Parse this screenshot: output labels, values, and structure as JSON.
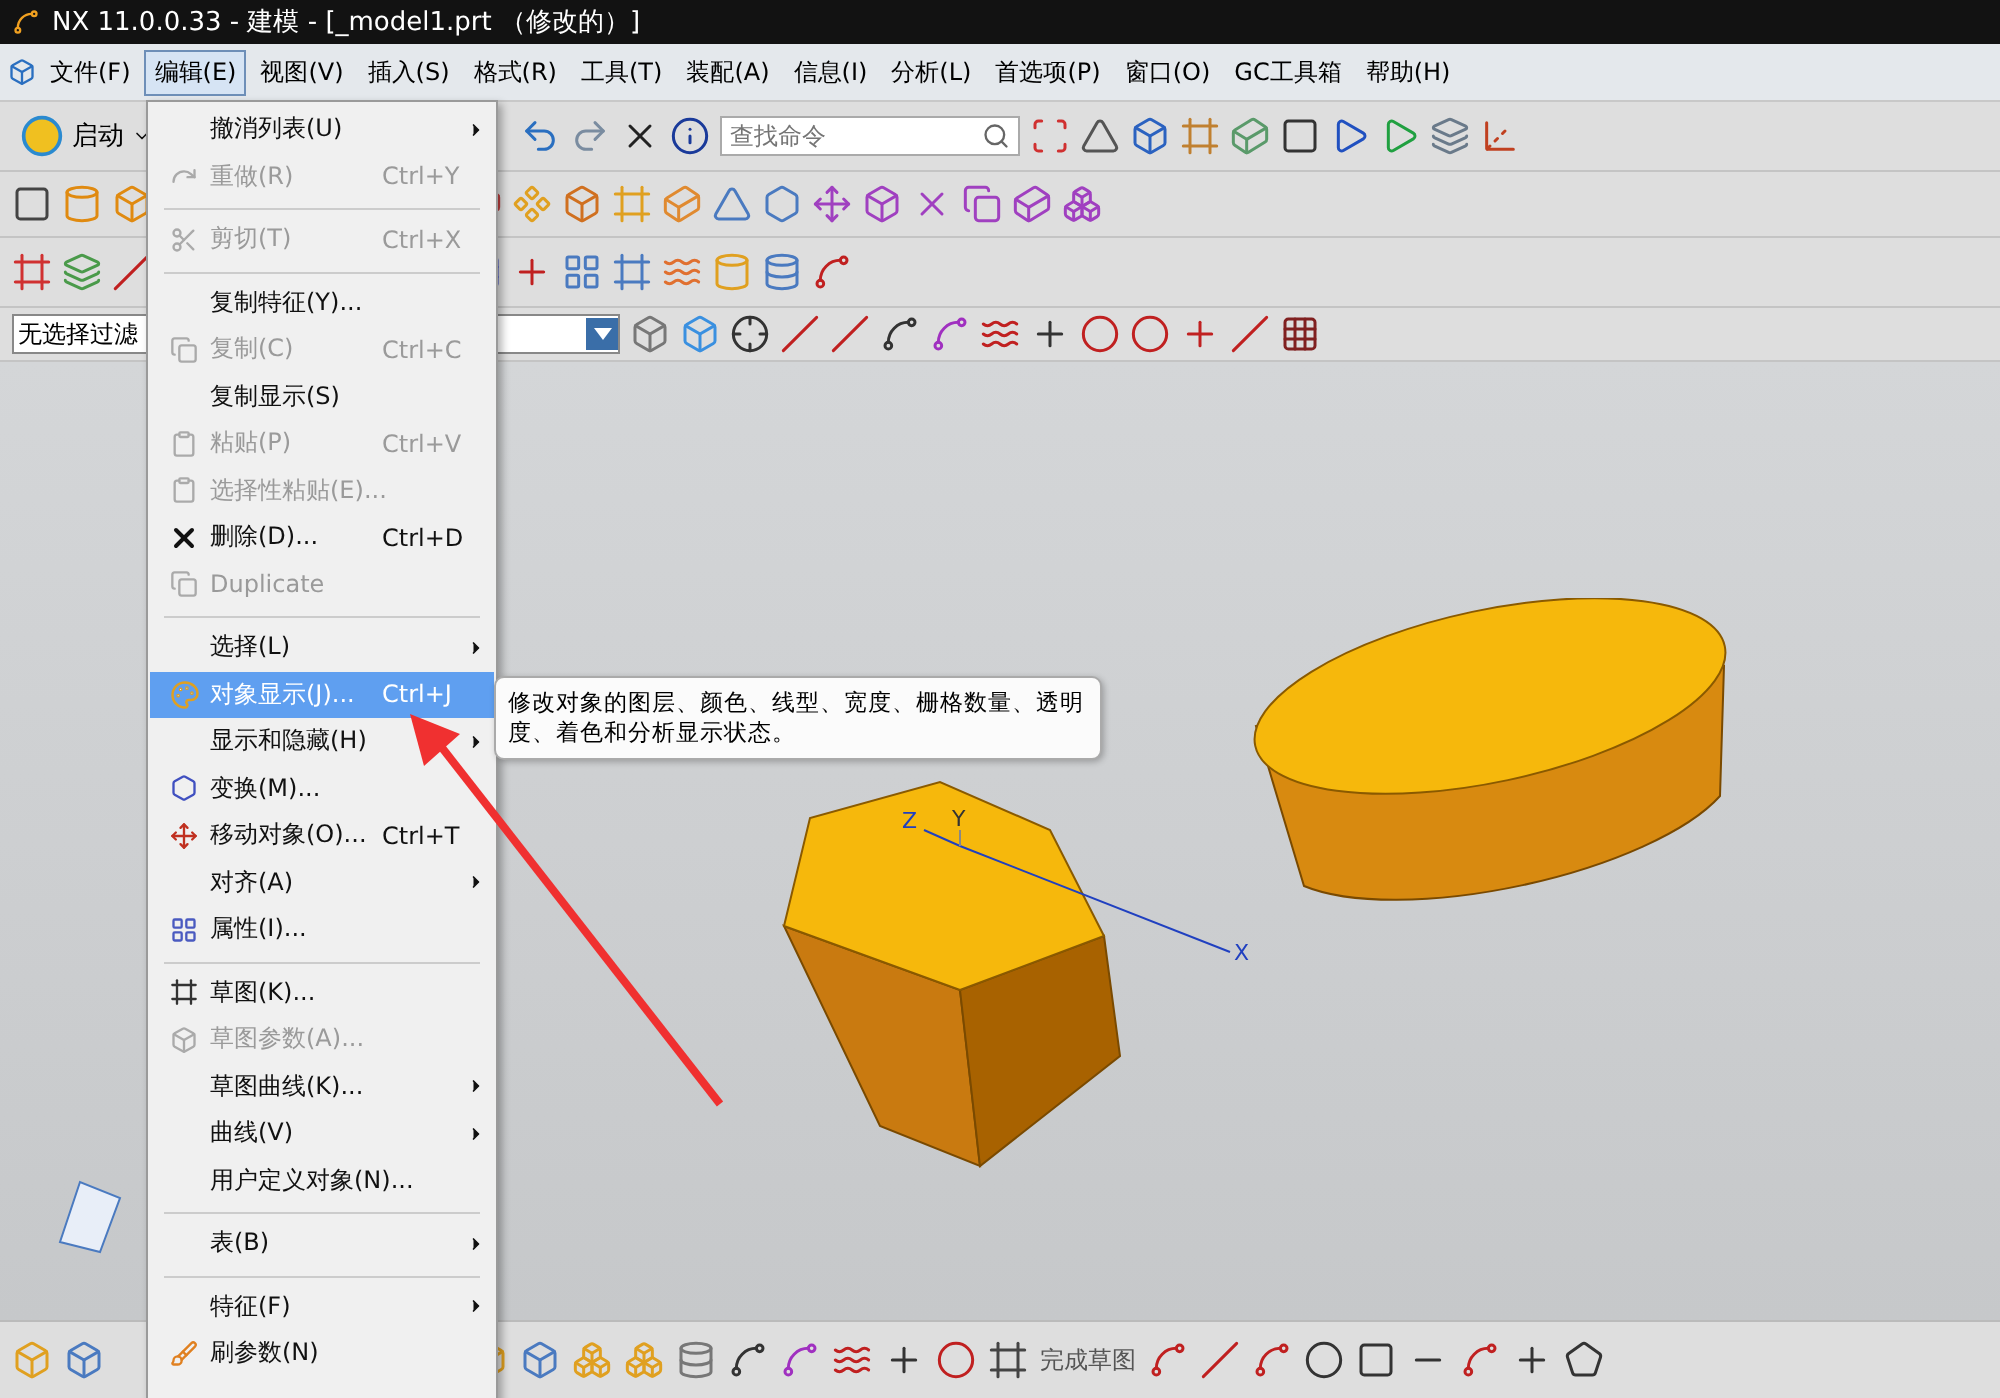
{
  "window": {
    "title": "NX 11.0.0.33 - 建模 - [_model1.prt （修改的）]"
  },
  "menu_bar": [
    {
      "label": "文件(F)",
      "selected": false
    },
    {
      "label": "编辑(E)",
      "selected": true
    },
    {
      "label": "视图(V)",
      "selected": false
    },
    {
      "label": "插入(S)",
      "selected": false
    },
    {
      "label": "格式(R)",
      "selected": false
    },
    {
      "label": "工具(T)",
      "selected": false
    },
    {
      "label": "装配(A)",
      "selected": false
    },
    {
      "label": "信息(I)",
      "selected": false
    },
    {
      "label": "分析(L)",
      "selected": false
    },
    {
      "label": "首选项(P)",
      "selected": false
    },
    {
      "label": "窗口(O)",
      "selected": false
    },
    {
      "label": "GC工具箱",
      "selected": false
    },
    {
      "label": "帮助(H)",
      "selected": false
    }
  ],
  "toolbar": {
    "start_button": "启动",
    "search": {
      "placeholder": "查找命令"
    },
    "filter": {
      "value": "无选择过滤"
    }
  },
  "edit_menu": [
    {
      "kind": "item",
      "label": "撤消列表(U)",
      "submenu": true,
      "disabled": false,
      "selected": false
    },
    {
      "kind": "item",
      "label": "重做(R)",
      "shortcut": "Ctrl+Y",
      "submenu": false,
      "disabled": true,
      "selected": false
    },
    {
      "kind": "separator"
    },
    {
      "kind": "item",
      "label": "剪切(T)",
      "shortcut": "Ctrl+X",
      "submenu": false,
      "disabled": true,
      "selected": false
    },
    {
      "kind": "separator"
    },
    {
      "kind": "item",
      "label": "复制特征(Y)...",
      "submenu": false,
      "disabled": false,
      "selected": false
    },
    {
      "kind": "item",
      "label": "复制(C)",
      "shortcut": "Ctrl+C",
      "submenu": false,
      "disabled": true,
      "selected": false
    },
    {
      "kind": "item",
      "label": "复制显示(S)",
      "submenu": false,
      "disabled": false,
      "selected": false
    },
    {
      "kind": "item",
      "label": "粘贴(P)",
      "shortcut": "Ctrl+V",
      "submenu": false,
      "disabled": true,
      "selected": false
    },
    {
      "kind": "item",
      "label": "选择性粘贴(E)...",
      "submenu": false,
      "disabled": true,
      "selected": false
    },
    {
      "kind": "item",
      "label": "删除(D)...",
      "shortcut": "Ctrl+D",
      "submenu": false,
      "disabled": false,
      "selected": false
    },
    {
      "kind": "item",
      "label": "Duplicate",
      "submenu": false,
      "disabled": true,
      "selected": false
    },
    {
      "kind": "separator"
    },
    {
      "kind": "item",
      "label": "选择(L)",
      "submenu": true,
      "disabled": false,
      "selected": false
    },
    {
      "kind": "item",
      "label": "对象显示(J)...",
      "shortcut": "Ctrl+J",
      "submenu": false,
      "disabled": false,
      "selected": true
    },
    {
      "kind": "item",
      "label": "显示和隐藏(H)",
      "submenu": true,
      "disabled": false,
      "selected": false
    },
    {
      "kind": "item",
      "label": "变换(M)...",
      "submenu": false,
      "disabled": false,
      "selected": false
    },
    {
      "kind": "item",
      "label": "移动对象(O)...",
      "shortcut": "Ctrl+T",
      "submenu": false,
      "disabled": false,
      "selected": false
    },
    {
      "kind": "item",
      "label": "对齐(A)",
      "submenu": true,
      "disabled": false,
      "selected": false
    },
    {
      "kind": "item",
      "label": "属性(I)...",
      "submenu": false,
      "disabled": false,
      "selected": false
    },
    {
      "kind": "separator"
    },
    {
      "kind": "item",
      "label": "草图(K)...",
      "submenu": false,
      "disabled": false,
      "selected": false
    },
    {
      "kind": "item",
      "label": "草图参数(A)...",
      "submenu": false,
      "disabled": true,
      "selected": false
    },
    {
      "kind": "item",
      "label": "草图曲线(K)...",
      "submenu": true,
      "disabled": false,
      "selected": false
    },
    {
      "kind": "item",
      "label": "曲线(V)",
      "submenu": true,
      "disabled": false,
      "selected": false
    },
    {
      "kind": "item",
      "label": "用户定义对象(N)...",
      "submenu": false,
      "disabled": false,
      "selected": false
    },
    {
      "kind": "separator"
    },
    {
      "kind": "item",
      "label": "表(B)",
      "submenu": true,
      "disabled": false,
      "selected": false
    },
    {
      "kind": "separator"
    },
    {
      "kind": "item",
      "label": "特征(F)",
      "submenu": true,
      "disabled": false,
      "selected": false
    },
    {
      "kind": "item",
      "label": "刷参数(N)",
      "submenu": false,
      "disabled": false,
      "selected": false
    }
  ],
  "tooltip": "修改对象的图层、颜色、线型、宽度、栅格数量、透明度、着色和分析显示状态。",
  "viewport": {
    "axes": {
      "x": "X",
      "y": "Y",
      "z": "Z"
    }
  },
  "bottom_toolbar": {
    "finish_sketch": "完成草图"
  }
}
